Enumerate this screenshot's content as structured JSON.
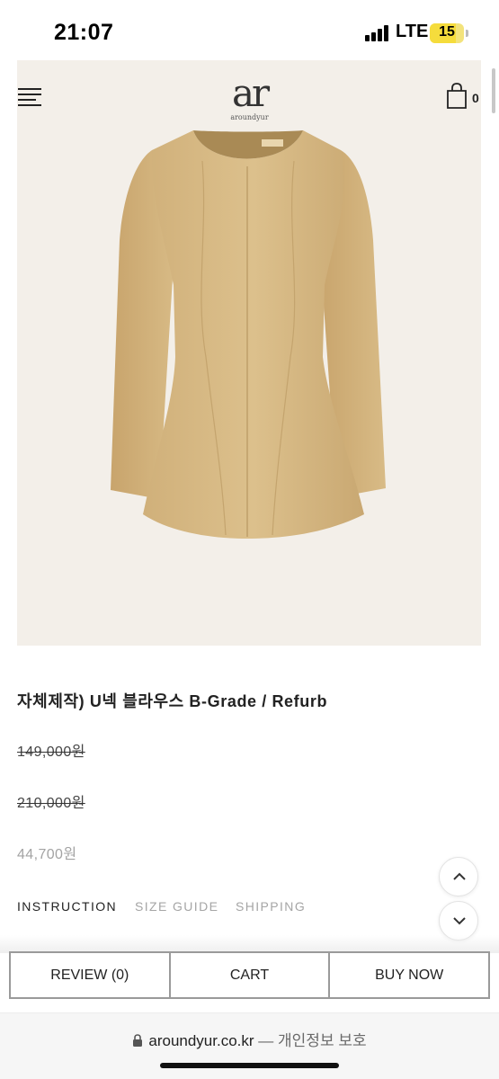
{
  "status_bar": {
    "time": "21:07",
    "network": "LTE",
    "battery_level": "15"
  },
  "header": {
    "logo_mark": "ar",
    "logo_text": "aroundyur",
    "cart_count": "0",
    "menu_icon": "hamburger-icon",
    "cart_icon": "shopping-bag-icon"
  },
  "product": {
    "title": "자체제작) U넥 블라우스 B-Grade / Refurb",
    "prices": [
      "149,000원",
      "210,000원",
      "44,700원"
    ],
    "image_background": "#f3efe9",
    "garment_color": "#dcc08c"
  },
  "tabs": [
    {
      "label": "INSTRUCTION",
      "active": true
    },
    {
      "label": "SIZE GUIDE",
      "active": false
    },
    {
      "label": "SHIPPING",
      "active": false
    }
  ],
  "scroll_buttons": {
    "up_icon": "chevron-up-icon",
    "down_icon": "chevron-down-icon"
  },
  "actions": {
    "review": "REVIEW (0)",
    "cart": "CART",
    "buy_now": "BUY NOW"
  },
  "browser": {
    "url": "aroundyur.co.kr",
    "separator": "—",
    "privacy": "개인정보 보호"
  }
}
